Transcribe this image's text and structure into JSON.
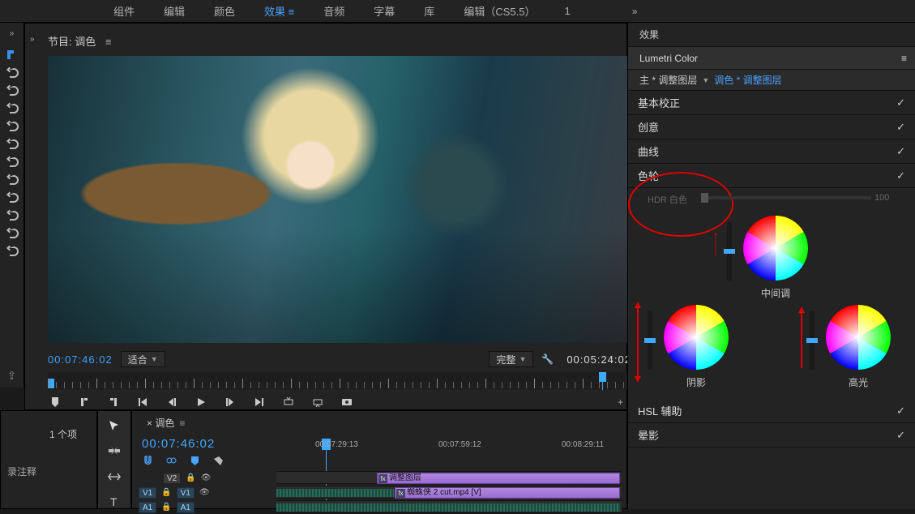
{
  "topbar": {
    "tabs": [
      "组件",
      "编辑",
      "颜色",
      "效果",
      "音频",
      "字幕",
      "库",
      "编辑（CS5.5）",
      "1"
    ],
    "active_index": 3,
    "more": "»"
  },
  "program": {
    "title": "节目: 调色",
    "menu_glyph": "≡",
    "chev": "»",
    "tc_in": "00:07:46:02",
    "fit_label": "适合",
    "full_label": "完整",
    "tc_dur": "00:05:24:02",
    "plus": "+"
  },
  "project": {
    "count": "1 个项",
    "note": "录注释"
  },
  "timeline": {
    "title": "× 调色",
    "menu_glyph": "≡",
    "tc": "00:07:46:02",
    "ruler": [
      "00:07:29:13",
      "00:07:59:12",
      "00:08:29:11"
    ],
    "tracks": {
      "v2": "V2",
      "v1": "V1",
      "a1": "A1"
    },
    "clip_adjust": "调整图层",
    "clip_video": "蜘蛛侠 2 cut.mp4 [V]"
  },
  "effects": {
    "header": "效果",
    "lumetri": "Lumetri Color",
    "menu_glyph": "≡",
    "clipref_main": "主 * 调整图层",
    "clipref_link": "调色 * 调整图层",
    "sections": {
      "basic": "基本校正",
      "creative": "创意",
      "curves": "曲线",
      "wheels": "色轮",
      "hsl": "HSL 辅助",
      "vignette": "晕影"
    },
    "hdr_white": "HDR 白色",
    "hdr_val": "100",
    "wheel_mid": "中间调",
    "wheel_shadow": "阴影",
    "wheel_highlight": "高光"
  }
}
